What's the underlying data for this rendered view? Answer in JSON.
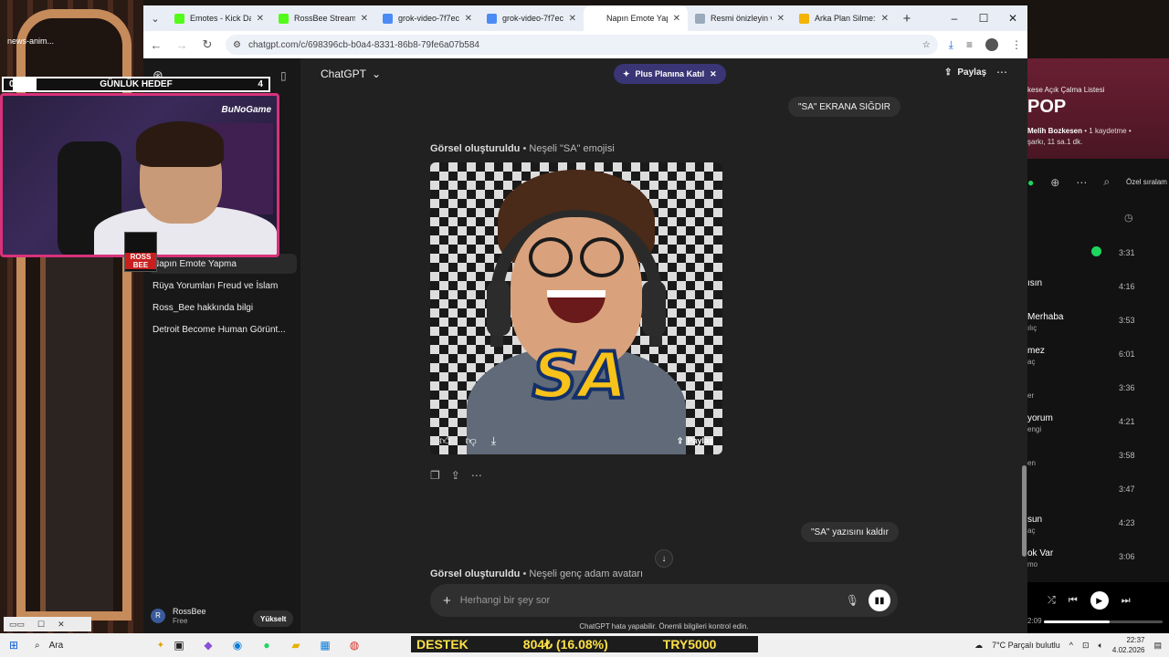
{
  "desktop": {
    "label": "news-anim...",
    "goal": {
      "title": "GÜNLÜK HEDEF",
      "current": "0",
      "target": "4",
      "progress": 0.0
    },
    "webcam_tag": "BuNoGame",
    "logo_text": "ROSS BEE"
  },
  "browser": {
    "tabs": [
      {
        "title": "Emotes - Kick Dash",
        "favicon": "kick-icon",
        "color": "#53fc18",
        "active": false
      },
      {
        "title": "RossBee Stream",
        "favicon": "kick-icon",
        "color": "#53fc18",
        "active": false
      },
      {
        "title": "grok-video-7f7ec3",
        "favicon": "grok-icon",
        "color": "#4b8bf5",
        "active": false
      },
      {
        "title": "grok-video-7f7ec3",
        "favicon": "grok-icon",
        "color": "#4b8bf5",
        "active": false
      },
      {
        "title": "Napın Emote Yapma",
        "favicon": "chatgpt-icon",
        "color": "#ffffff",
        "active": true
      },
      {
        "title": "Resmi önizleyin ve",
        "favicon": "remove-bg-icon",
        "color": "#9ab",
        "active": false
      },
      {
        "title": "Arka Plan Silme: S",
        "favicon": "bg-remove-icon",
        "color": "#f4b400",
        "active": false
      }
    ],
    "url": "chatgpt.com/c/698396cb-b0a4-8331-86b8-79fe6a07b584"
  },
  "chatgpt": {
    "model": "ChatGPT",
    "plus_label": "Plus Planına Katıl",
    "share_label": "Paylaş",
    "sidebar": {
      "chats": [
        {
          "label": "Napın Emote Yapma",
          "selected": true
        },
        {
          "label": "Rüya Yorumları Freud ve İslam",
          "selected": false
        },
        {
          "label": "Ross_Bee hakkında bilgi",
          "selected": false
        },
        {
          "label": "Detroit Become Human Görünt...",
          "selected": false
        }
      ],
      "user_initial": "R",
      "user_name": "RossBee",
      "user_plan": "Free",
      "upgrade": "Yükselt"
    },
    "messages": {
      "user1": "\"SA\" EKRANA SIĞDIR",
      "image1_status": "Görsel oluşturuldu",
      "image1_desc": "• Neşeli \"SA\" emojisi",
      "image1_text": "SA",
      "image_share": "Paylaş",
      "user2": "\"SA\" yazısını kaldır",
      "image2_status": "Görsel oluşturuldu",
      "image2_desc": "• Neşeli genç adam avatarı"
    },
    "composer_placeholder": "Herhangi bir şey sor",
    "disclaimer": "ChatGPT hata yapabilir. Önemli bilgileri kontrol edin."
  },
  "spotify": {
    "subtitle": "kese Açık Çalma Listesi",
    "title": "POP",
    "owner": "Melih Bozkesen",
    "meta1": "• 1 kaydetme •",
    "meta2": "şarkı, 11 sa.1 dk.",
    "sort": "Özel sıralam",
    "tracks": [
      {
        "title": "",
        "artist": "",
        "duration": "3:31",
        "saved": true
      },
      {
        "title": "ısın",
        "artist": "",
        "duration": "4:16",
        "saved": false
      },
      {
        "title": "Merhaba",
        "artist": "ılıç",
        "duration": "3:53",
        "saved": false
      },
      {
        "title": "mez",
        "artist": "aç",
        "duration": "6:01",
        "saved": false
      },
      {
        "title": "",
        "artist": "er",
        "duration": "3:36",
        "saved": false
      },
      {
        "title": "yorum",
        "artist": "engi",
        "duration": "4:21",
        "saved": false
      },
      {
        "title": "",
        "artist": "en",
        "duration": "3:58",
        "saved": false
      },
      {
        "title": "",
        "artist": "",
        "duration": "3:47",
        "saved": false
      },
      {
        "title": "sun",
        "artist": "aç",
        "duration": "4:23",
        "saved": false
      },
      {
        "title": "ok Var",
        "artist": "mo",
        "duration": "3:06",
        "saved": false
      }
    ],
    "player_time": "2:09",
    "progress": 0.55
  },
  "taskbar": {
    "search": "Ara",
    "ticker": [
      "DESTEK",
      "804₺ (16.08%)",
      "TRY5000"
    ],
    "weather": "7°C  Parçalı bulutlu",
    "time": "22:37",
    "date": "4.02.2026"
  },
  "small_window": {
    "label": "Sürükle"
  }
}
